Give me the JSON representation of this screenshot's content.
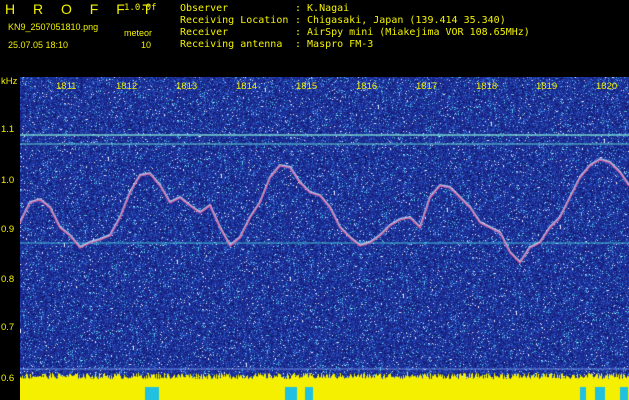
{
  "header": {
    "title": "H R O F F T",
    "version": "1.0.0f",
    "filename": "KN9_2507051810.png",
    "meteor_label": "meteor",
    "meteor_count": "10",
    "datetime": "25.07.05 18:10"
  },
  "info": {
    "rows": [
      {
        "label": "Observer",
        "value": ": K.Nagai"
      },
      {
        "label": "Receiving Location",
        "value": ": Chigasaki, Japan (139.414 35.340)"
      },
      {
        "label": "Receiver",
        "value": ": AirSpy mini (Miakejima VOR 108.65MHz)"
      },
      {
        "label": "Receiving antenna",
        "value": ": Maspro FM-3"
      }
    ]
  },
  "axis": {
    "y_unit": "kHz",
    "y_ticks": [
      "1.1",
      "1.0",
      "0.9",
      "0.8",
      "0.7",
      "0.6"
    ],
    "x_ticks": [
      "1811",
      "1812",
      "1813",
      "1814",
      "1815",
      "1816",
      "1817",
      "1818",
      "1819",
      "1820"
    ]
  },
  "colors": {
    "text": "#f2f200",
    "background": "#000000",
    "spectrogram_base": "#1a2a9a",
    "signal_trace": "#e060a0"
  }
}
